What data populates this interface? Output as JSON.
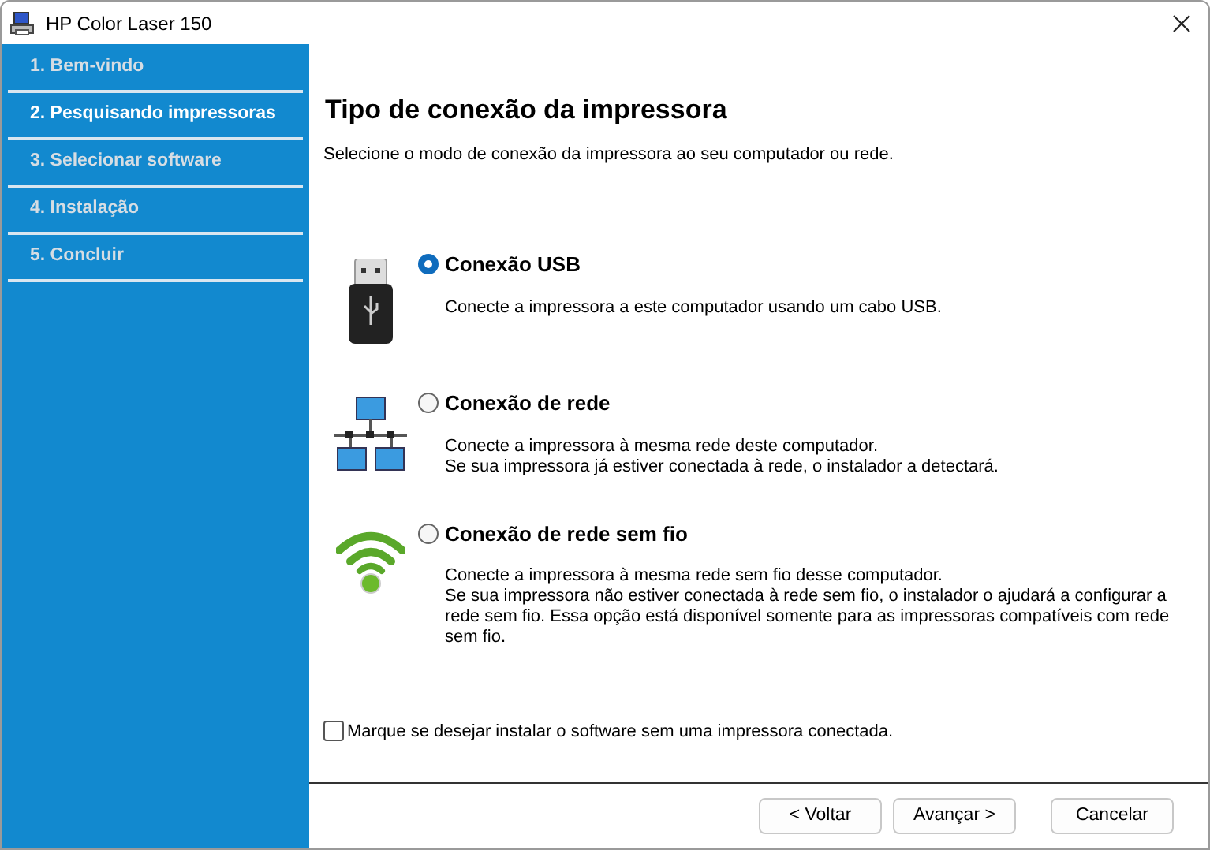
{
  "window": {
    "title": "HP Color Laser 150"
  },
  "steps": [
    {
      "label": "1. Bem-vindo",
      "selected": false
    },
    {
      "label": "2. Pesquisando impressoras",
      "selected": true
    },
    {
      "label": "3. Selecionar software",
      "selected": false
    },
    {
      "label": "4. Instalação",
      "selected": false
    },
    {
      "label": "5. Concluir",
      "selected": false
    }
  ],
  "heading": "Tipo de conexão da impressora",
  "subheading": "Selecione o modo de conexão da impressora ao seu computador ou rede.",
  "options": [
    {
      "kind": "usb",
      "label": "Conexão USB",
      "selected": true,
      "description": [
        "Conecte a impressora a este computador usando um cabo USB."
      ]
    },
    {
      "kind": "network",
      "label": "Conexão de rede",
      "selected": false,
      "description": [
        "Conecte a impressora à mesma rede deste computador.",
        "Se sua impressora já estiver conectada à rede, o instalador a detectará."
      ]
    },
    {
      "kind": "wireless",
      "label": "Conexão de rede sem fio",
      "selected": false,
      "description": [
        "Conecte a impressora à mesma rede sem fio desse computador.",
        "Se sua impressora não estiver conectada à rede sem fio, o instalador o ajudará a configurar a rede sem fio. Essa opção está disponível somente para as impressoras compatíveis com rede sem fio."
      ]
    }
  ],
  "no_printer_checkbox": {
    "label": "Marque se desejar instalar o software sem uma impressora conectada.",
    "checked": false
  },
  "buttons": [
    "< Voltar",
    "Avançar >",
    "Cancelar"
  ]
}
